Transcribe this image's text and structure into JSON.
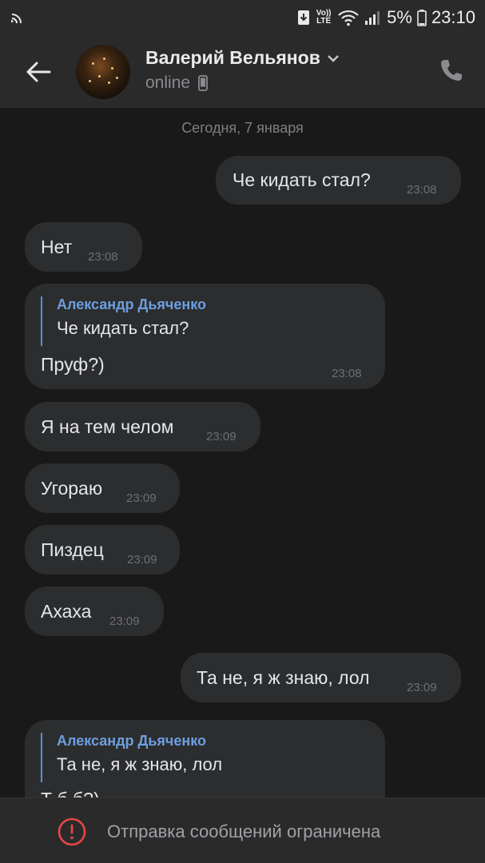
{
  "status_bar": {
    "volte_top": "Vo))",
    "volte_bottom": "LTE",
    "battery": "5%",
    "time": "23:10",
    "icons": [
      "cast-icon",
      "download-icon",
      "wifi-icon",
      "signal-icon",
      "battery-icon"
    ]
  },
  "header": {
    "contact_name": "Валерий Вельянов",
    "contact_status": "online",
    "icons": [
      "back-arrow-icon",
      "chevron-down-icon",
      "mobile-device-icon",
      "phone-icon"
    ]
  },
  "chat": {
    "date_separator": "Сегодня, 7 января",
    "messages": [
      {
        "text": "Че кидать стал?",
        "time": "23:08",
        "outgoing": true
      },
      {
        "text": "Нет",
        "time": "23:08",
        "outgoing": false
      },
      {
        "reply_author": "Александр Дьяченко",
        "reply_text": "Че кидать стал?",
        "text": "Пруф?)",
        "time": "23:08",
        "outgoing": false
      },
      {
        "text": "Я на тем челом",
        "time": "23:09",
        "outgoing": false
      },
      {
        "text": "Угораю",
        "time": "23:09",
        "outgoing": false
      },
      {
        "text": "Пиздец",
        "time": "23:09",
        "outgoing": false
      },
      {
        "text": "Ахаха",
        "time": "23:09",
        "outgoing": false
      },
      {
        "text": "Та не, я ж знаю, лол",
        "time": "23:09",
        "outgoing": true
      },
      {
        "reply_author": "Александр Дьяченко",
        "reply_text": "Та не, я ж знаю, лол",
        "text": "Т      б б?)",
        "time": "",
        "outgoing": false
      }
    ]
  },
  "footer": {
    "restriction_text": "Отправка сообщений ограничена",
    "icon": "alert-circle-icon"
  },
  "colors": {
    "background": "#191919",
    "bar": "#2a2a2b",
    "bubble": "#2c2d2e",
    "accent": "#6d9fe0",
    "warning": "#e64646"
  }
}
